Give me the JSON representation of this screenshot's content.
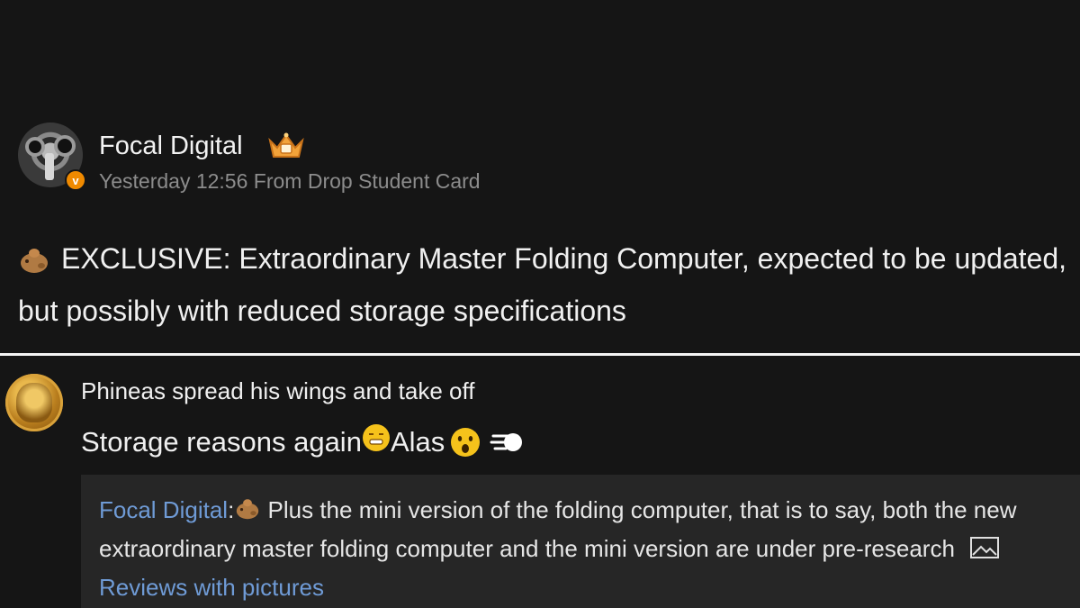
{
  "post": {
    "author": "Focal Digital",
    "meta": "Yesterday 12:56 From Drop Student Card",
    "text": "EXCLUSIVE: Extraordinary Master Folding Computer, expected to be updated, but possibly with reduced storage specifications"
  },
  "comment": {
    "author": "Phineas spread his wings and take off",
    "text_part1": "Storage reasons again",
    "text_part2": "Alas",
    "quote": {
      "author": "Focal Digital",
      "colon": ":",
      "text": " Plus the mini version of the folding computer, that is to say, both the new extraordinary master folding computer and the mini version are under pre-research ",
      "link": "Reviews with pictures"
    }
  },
  "colors": {
    "background": "#151515",
    "quote_background": "#262626",
    "link": "#6f9bd6",
    "meta_text": "#8c8c8c",
    "badge": "#f08a00"
  },
  "icons": [
    "crown-icon",
    "verified-badge-icon",
    "capybara-emoji-icon",
    "grimace-emoji-icon",
    "surprised-emoji-icon",
    "dash-emoji-icon",
    "picture-icon"
  ]
}
